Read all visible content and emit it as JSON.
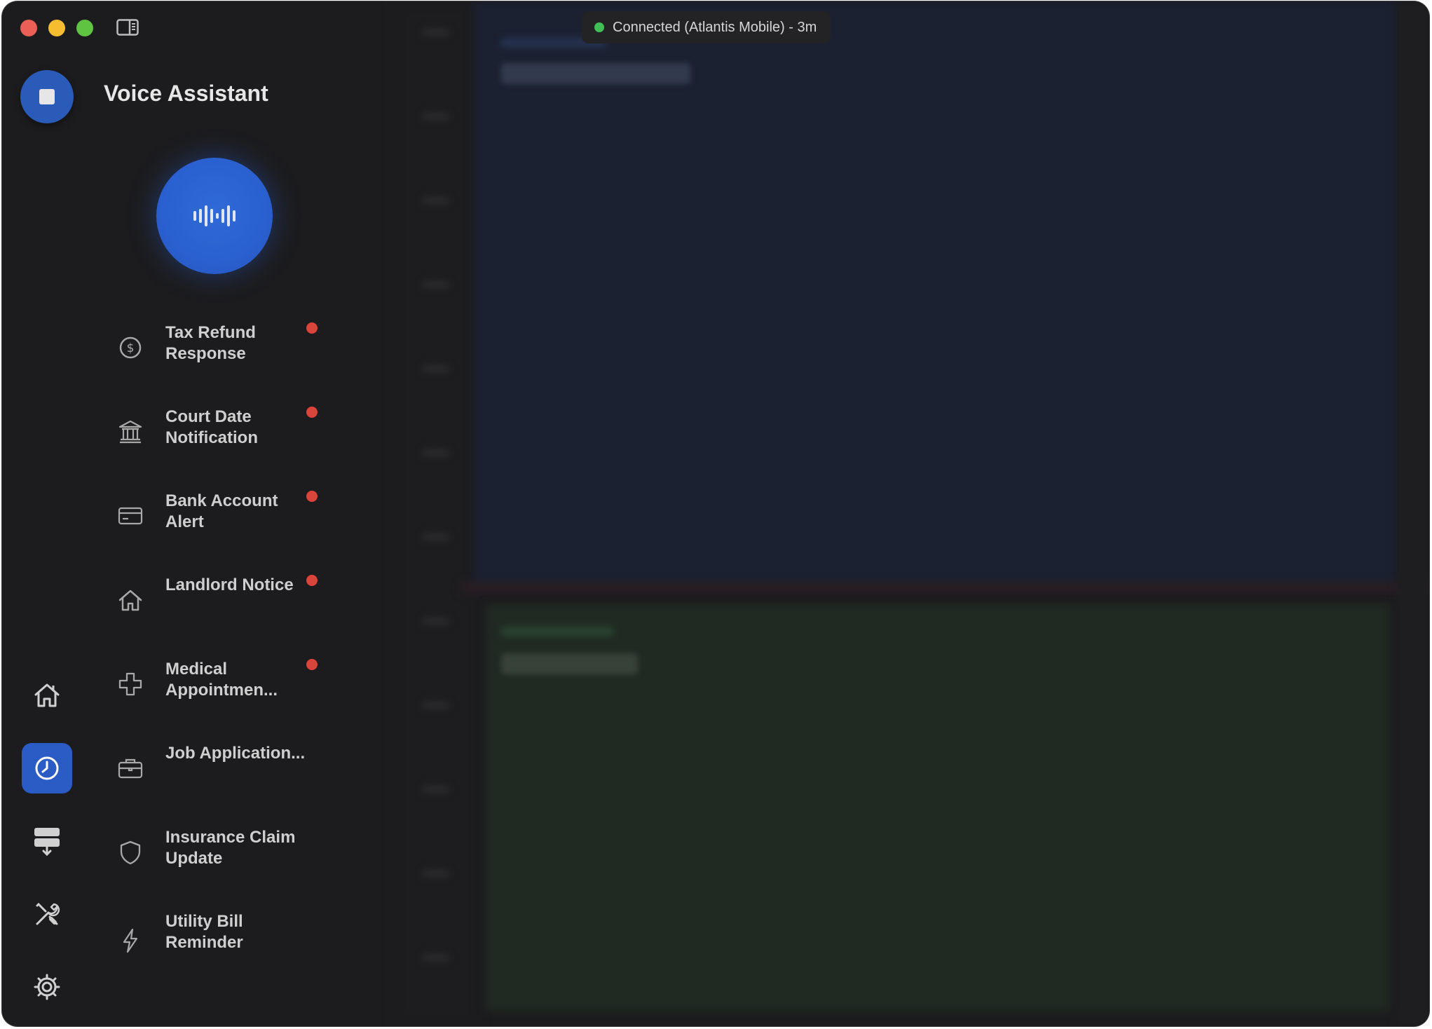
{
  "status": {
    "text": "Connected (Atlantis Mobile) - 3m",
    "dot_color": "#3fbf55"
  },
  "header": {
    "title": "Voice Assistant",
    "stop_icon": "stop-icon"
  },
  "voice_orb": {
    "icon": "waveform-icon",
    "color": "#2b5fcc"
  },
  "rail": {
    "items": [
      {
        "name": "home",
        "icon": "home-icon",
        "active": false
      },
      {
        "name": "history",
        "icon": "clock-icon",
        "active": true
      },
      {
        "name": "storage",
        "icon": "server-download-icon",
        "active": false
      },
      {
        "name": "tools",
        "icon": "tools-icon",
        "active": false
      },
      {
        "name": "settings",
        "icon": "gear-icon",
        "active": false
      }
    ],
    "accent": "#2b5bc4"
  },
  "conversations": [
    {
      "label": "Tax Refund Response",
      "icon": "dollar-circle-icon",
      "unread": true
    },
    {
      "label": "Court Date Notification",
      "icon": "courthouse-icon",
      "unread": true
    },
    {
      "label": "Bank Account Alert",
      "icon": "credit-card-icon",
      "unread": true
    },
    {
      "label": "Landlord Notice",
      "icon": "house-icon",
      "unread": true
    },
    {
      "label": "Medical Appointmen...",
      "icon": "medical-cross-icon",
      "unread": true
    },
    {
      "label": "Job Application...",
      "icon": "briefcase-icon",
      "unread": false
    },
    {
      "label": "Insurance Claim Update",
      "icon": "shield-icon",
      "unread": false
    },
    {
      "label": "Utility Bill Reminder",
      "icon": "lightning-icon",
      "unread": false
    }
  ],
  "unread_color": "#d9443c"
}
